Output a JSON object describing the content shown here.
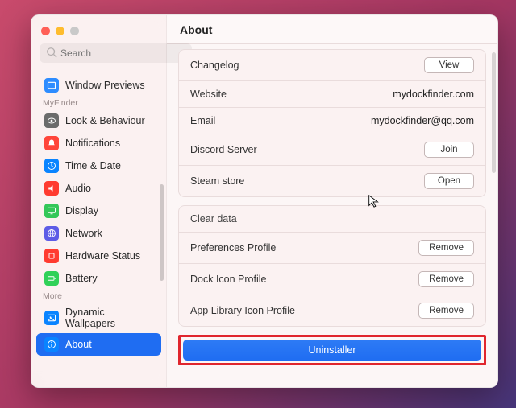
{
  "title": "About",
  "search": {
    "placeholder": "Search"
  },
  "sidebar": {
    "group_myfinder": "MyFinder",
    "group_more": "More",
    "items": [
      {
        "label": "Window Previews",
        "color": "#2d8cff",
        "icon": "window"
      },
      {
        "label": "Look & Behaviour",
        "color": "#6b6b6b",
        "icon": "eye"
      },
      {
        "label": "Notifications",
        "color": "#ff453a",
        "icon": "bell"
      },
      {
        "label": "Time & Date",
        "color": "#0a84ff",
        "icon": "clock"
      },
      {
        "label": "Audio",
        "color": "#ff3b30",
        "icon": "speaker"
      },
      {
        "label": "Display",
        "color": "#34c759",
        "icon": "display"
      },
      {
        "label": "Network",
        "color": "#5e5ce6",
        "icon": "globe"
      },
      {
        "label": "Hardware Status",
        "color": "#ff3b30",
        "icon": "cpu"
      },
      {
        "label": "Battery",
        "color": "#30d158",
        "icon": "battery"
      },
      {
        "label": "Dynamic Wallpapers",
        "color": "#0a84ff",
        "icon": "picture"
      },
      {
        "label": "About",
        "color": "#0a84ff",
        "icon": "info"
      }
    ]
  },
  "links": {
    "changelog_label": "Changelog",
    "changelog_button": "View",
    "website_label": "Website",
    "website_value": "mydockfinder.com",
    "email_label": "Email",
    "email_value": "mydockfinder@qq.com",
    "discord_label": "Discord Server",
    "discord_button": "Join",
    "steam_label": "Steam store",
    "steam_button": "Open"
  },
  "clear": {
    "header": "Clear data",
    "pref_label": "Preferences Profile",
    "pref_button": "Remove",
    "dock_label": "Dock Icon Profile",
    "dock_button": "Remove",
    "lib_label": "App Library Icon Profile",
    "lib_button": "Remove"
  },
  "uninstaller_label": "Uninstaller"
}
